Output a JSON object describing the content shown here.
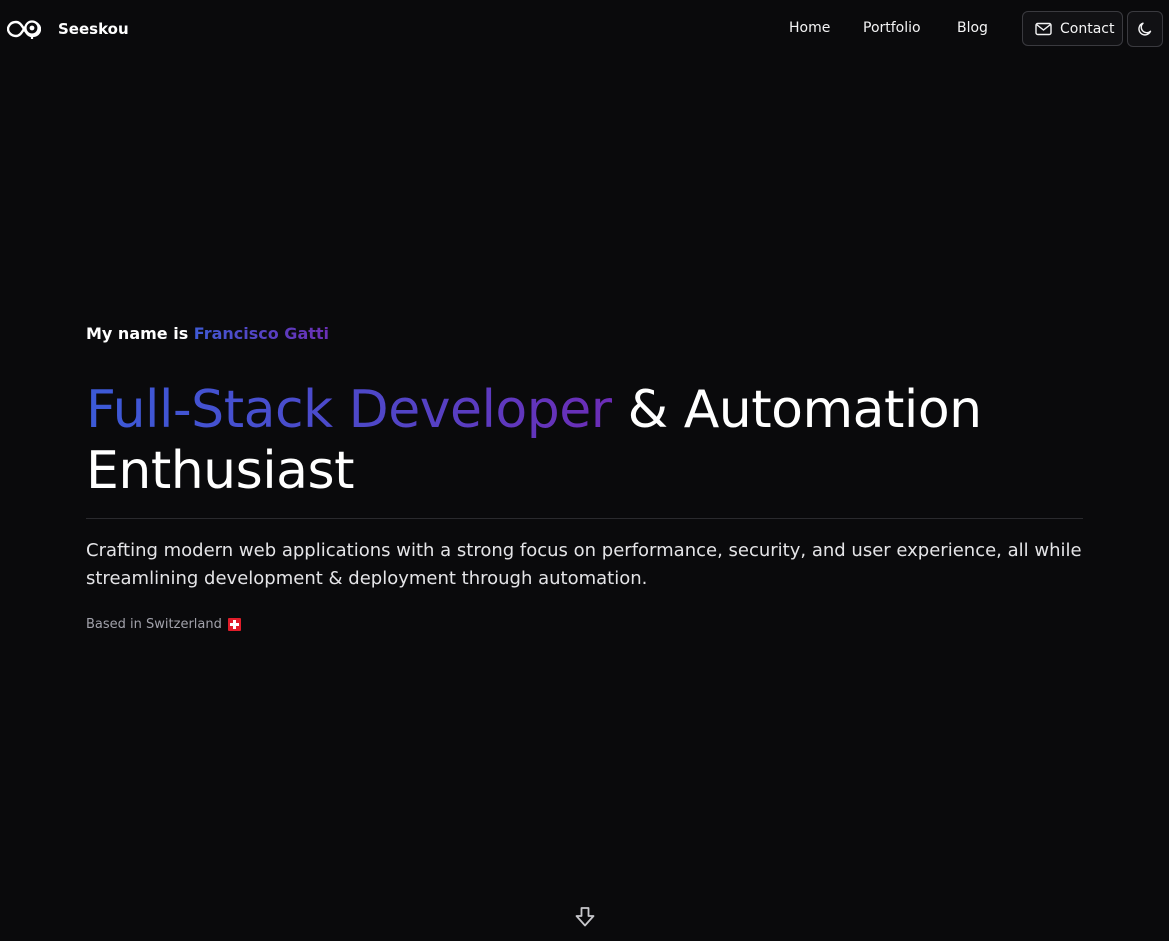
{
  "brand": {
    "name": "Seeskou",
    "logo_icon": "infinity-gear-logo-icon"
  },
  "nav": {
    "items": [
      {
        "label": "Home"
      },
      {
        "label": "Portfolio"
      },
      {
        "label": "Blog"
      }
    ],
    "contact_label": "Contact",
    "contact_icon": "mail-icon",
    "theme_icon": "moon-icon"
  },
  "hero": {
    "intro_prefix": "My name is ",
    "name": "Francisco Gatti",
    "headline_highlight": "Full-Stack Developer",
    "headline_rest": " & Automation",
    "headline_line2": "Enthusiast",
    "tagline": "Crafting modern web applications with a strong focus on performance, security, and user experience, all while streamlining development & deployment through automation.",
    "location_text": "Based in Switzerland",
    "location_flag": "swiss-flag-icon"
  },
  "scroll": {
    "icon": "arrow-down-icon"
  },
  "colors": {
    "background": "#0a0a0c",
    "gradient_start": "#3c5ad8",
    "gradient_end": "#6c2cb6",
    "text": "#ffffff",
    "muted": "#a1a1aa"
  }
}
